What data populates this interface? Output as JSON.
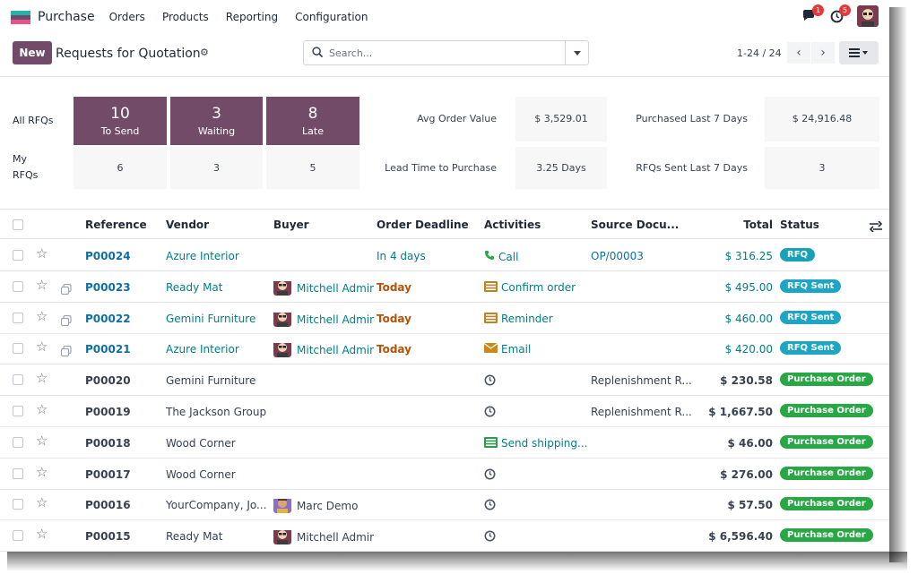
{
  "nav": {
    "app_name": "Purchase",
    "menu": [
      "Orders",
      "Products",
      "Reporting",
      "Configuration"
    ],
    "messages_badge": "1",
    "activities_badge": "5"
  },
  "control_panel": {
    "new_label": "New",
    "title": "Requests for Quotation",
    "search_placeholder": "Search...",
    "pager": "1-24 / 24"
  },
  "dashboard": {
    "all_rfqs_label": "All RFQs",
    "my_rfqs_label": "My RFQs",
    "all": [
      {
        "value": "10",
        "label": "To Send"
      },
      {
        "value": "3",
        "label": "Waiting"
      },
      {
        "value": "8",
        "label": "Late"
      }
    ],
    "my": [
      "6",
      "3",
      "5"
    ],
    "kpis": {
      "avg_order_value_label": "Avg Order Value",
      "avg_order_value": "$ 3,529.01",
      "purchased_7d_label": "Purchased Last 7 Days",
      "purchased_7d": "$ 24,916.48",
      "lead_time_label": "Lead Time to Purchase",
      "lead_time": "3.25 Days",
      "rfqs_sent_7d_label": "RFQs Sent Last 7 Days",
      "rfqs_sent_7d": "3"
    }
  },
  "table": {
    "columns": {
      "reference": "Reference",
      "vendor": "Vendor",
      "buyer": "Buyer",
      "deadline": "Order Deadline",
      "activities": "Activities",
      "source": "Source Docu...",
      "total": "Total",
      "status": "Status"
    },
    "rows": [
      {
        "reference": "P00024",
        "vendor": "Azure Interior",
        "buyer": "",
        "deadline": "In 4 days",
        "activity": "Call",
        "activity_icon": "phone-icon",
        "source": "OP/00003",
        "total": "$ 316.25",
        "status": "RFQ"
      },
      {
        "reference": "P00023",
        "vendor": "Ready Mat",
        "buyer": "Mitchell Admin",
        "deadline": "Today",
        "activity": "Confirm order",
        "activity_icon": "todo-list-icon",
        "source": "",
        "total": "$ 495.00",
        "status": "RFQ Sent"
      },
      {
        "reference": "P00022",
        "vendor": "Gemini Furniture",
        "buyer": "Mitchell Admin",
        "deadline": "Today",
        "activity": "Reminder",
        "activity_icon": "todo-list-icon",
        "source": "",
        "total": "$ 460.00",
        "status": "RFQ Sent"
      },
      {
        "reference": "P00021",
        "vendor": "Azure Interior",
        "buyer": "Mitchell Admin",
        "deadline": "Today",
        "activity": "Email",
        "activity_icon": "envelope-icon",
        "source": "",
        "total": "$ 420.00",
        "status": "RFQ Sent"
      },
      {
        "reference": "P00020",
        "vendor": "Gemini Furniture",
        "buyer": "",
        "deadline": "",
        "activity": "",
        "activity_icon": "clock-icon",
        "source": "Replenishment R...",
        "total": "$ 230.58",
        "status": "Purchase Order"
      },
      {
        "reference": "P00019",
        "vendor": "The Jackson Group",
        "buyer": "",
        "deadline": "",
        "activity": "",
        "activity_icon": "clock-icon",
        "source": "Replenishment R...",
        "total": "$ 1,667.50",
        "status": "Purchase Order"
      },
      {
        "reference": "P00018",
        "vendor": "Wood Corner",
        "buyer": "",
        "deadline": "",
        "activity": "Send shipping...",
        "activity_icon": "todo-list-icon",
        "source": "",
        "total": "$ 46.00",
        "status": "Purchase Order"
      },
      {
        "reference": "P00017",
        "vendor": "Wood Corner",
        "buyer": "",
        "deadline": "",
        "activity": "",
        "activity_icon": "clock-icon",
        "source": "",
        "total": "$ 276.00",
        "status": "Purchase Order"
      },
      {
        "reference": "P00016",
        "vendor": "YourCompany, Jo...",
        "buyer": "Marc Demo",
        "deadline": "",
        "activity": "",
        "activity_icon": "clock-icon",
        "source": "",
        "total": "$ 57.50",
        "status": "Purchase Order"
      },
      {
        "reference": "P00015",
        "vendor": "Ready Mat",
        "buyer": "Mitchell Admin",
        "deadline": "",
        "activity": "",
        "activity_icon": "clock-icon",
        "source": "",
        "total": "$ 6,596.40",
        "status": "Purchase Order"
      }
    ]
  },
  "colors": {
    "brand": "#714b67",
    "link": "#017e84",
    "status_rfq": "#17a2b8",
    "status_sent": "#1ea5c4",
    "status_po": "#28a745",
    "today": "#b45309"
  }
}
